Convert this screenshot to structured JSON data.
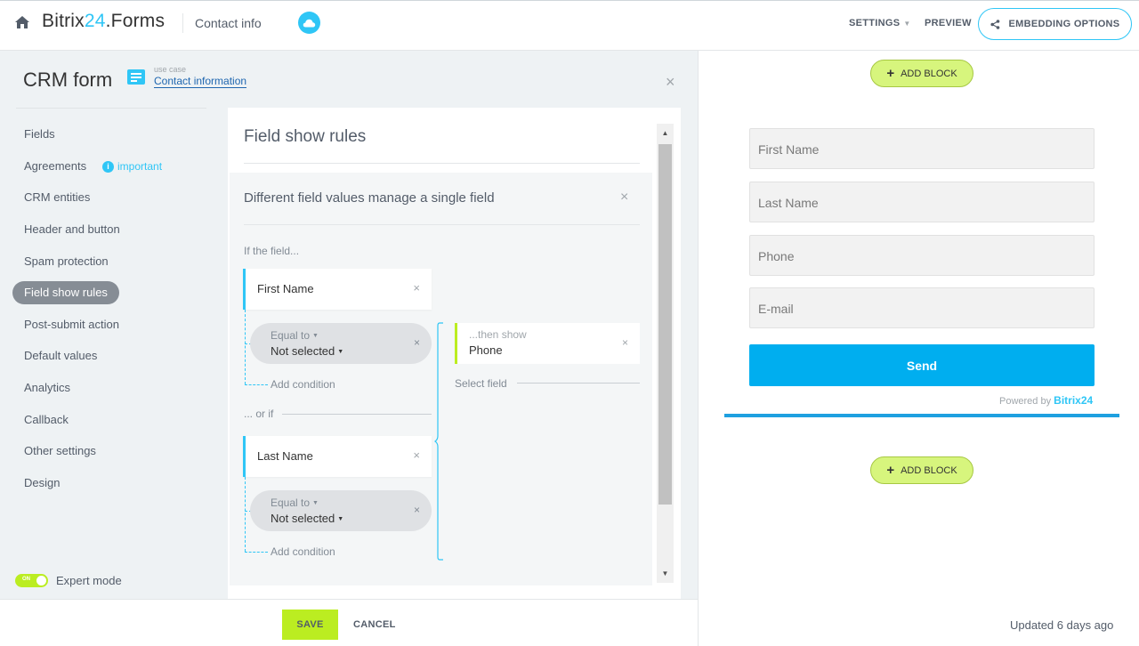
{
  "header": {
    "brand_main": "Bitrix",
    "brand_accent": "24",
    "brand_tail": ".Forms",
    "form_name": "Contact info",
    "settings_label": "SETTINGS",
    "preview_label": "PREVIEW",
    "embedding_label": "EMBEDDING OPTIONS"
  },
  "panel": {
    "title": "CRM form",
    "use_case_label": "use case",
    "use_case_value": "Contact information",
    "close_icon": "×"
  },
  "menu": {
    "items": [
      {
        "label": "Fields"
      },
      {
        "label": "Agreements"
      },
      {
        "label": "CRM entities"
      },
      {
        "label": "Header and button"
      },
      {
        "label": "Spam protection"
      },
      {
        "label": "Field show rules"
      },
      {
        "label": "Post-submit action"
      },
      {
        "label": "Default values"
      },
      {
        "label": "Analytics"
      },
      {
        "label": "Callback"
      },
      {
        "label": "Other settings"
      },
      {
        "label": "Design"
      }
    ],
    "important_label": "important",
    "important_icon": "i",
    "active_index": 5
  },
  "expert": {
    "toggle_text": "ON",
    "label": "Expert mode",
    "enabled": true
  },
  "rules": {
    "title": "Field show rules",
    "rule_title": "Different field values manage a single field",
    "if_label": "If the field...",
    "or_if_label": "... or if",
    "conditions": [
      {
        "field": "First Name",
        "operator_label": "Equal to",
        "value": "Not selected",
        "add_condition": "Add condition"
      },
      {
        "field": "Last Name",
        "operator_label": "Equal to",
        "value": "Not selected",
        "add_condition": "Add condition"
      }
    ],
    "then_label": "...then show",
    "then_value": "Phone",
    "select_field": "Select field",
    "close_glyph": "×"
  },
  "footer": {
    "save_label": "SAVE",
    "cancel_label": "CANCEL"
  },
  "preview": {
    "add_block_label": "ADD BLOCK",
    "fields": [
      {
        "placeholder": "First Name"
      },
      {
        "placeholder": "Last Name"
      },
      {
        "placeholder": "Phone"
      },
      {
        "placeholder": "E-mail"
      }
    ],
    "send_label": "Send",
    "powered_label": "Powered by",
    "powered_brand": "Bitrix",
    "powered_brand_num": "24",
    "updated": "Updated 6 days ago"
  },
  "colors": {
    "accent": "#2fc6f6",
    "green": "#bbed21",
    "send": "#00aeef"
  }
}
